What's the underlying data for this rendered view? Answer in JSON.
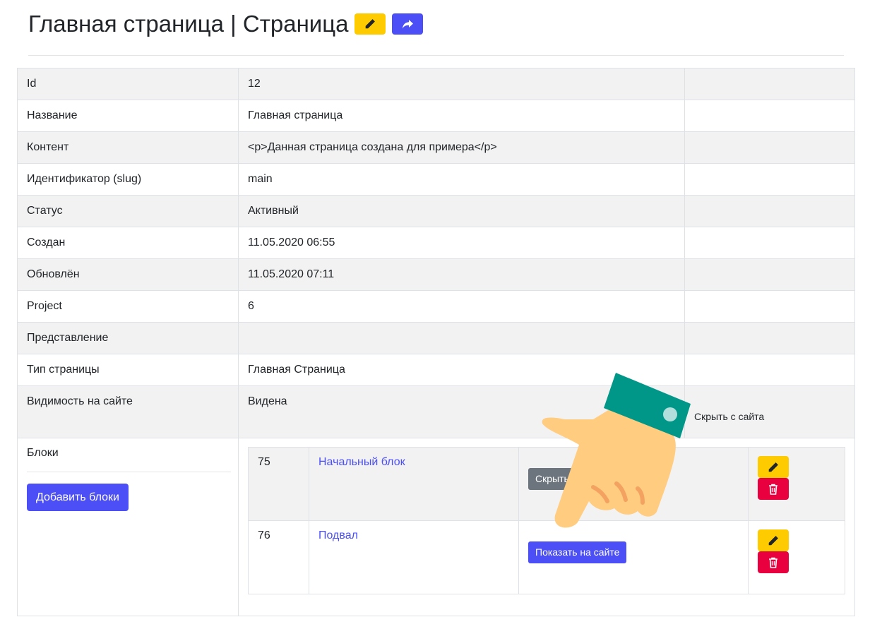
{
  "header": {
    "title": "Главная страница | Страница",
    "edit_icon": "pencil-icon",
    "share_icon": "share-arrow-icon"
  },
  "details": [
    {
      "label": "Id",
      "value": "12"
    },
    {
      "label": "Название",
      "value": "Главная страница"
    },
    {
      "label": "Контент",
      "value": "<p>Данная страница создана для примера</p>"
    },
    {
      "label": "Идентификатор (slug)",
      "value": "main"
    },
    {
      "label": "Статус",
      "value": "Активный"
    },
    {
      "label": "Создан",
      "value": "11.05.2020 06:55"
    },
    {
      "label": "Обновлён",
      "value": "11.05.2020 07:11"
    },
    {
      "label": "Project",
      "value": "6"
    },
    {
      "label": "Представление",
      "value": ""
    },
    {
      "label": "Тип страницы",
      "value": "Главная Страница"
    }
  ],
  "visibility": {
    "label": "Видимость на сайте",
    "value": "Видена",
    "action": "Скрыть с сайта"
  },
  "blocks": {
    "label": "Блоки",
    "add_button": "Добавить блоки",
    "rows": [
      {
        "id": "75",
        "name": "Начальный блок",
        "action": "Скрыть с сайта"
      },
      {
        "id": "76",
        "name": "Подвал",
        "action": "Показать на сайте"
      }
    ]
  },
  "colors": {
    "accent": "#4b4ff5",
    "warning": "#fecb00",
    "danger": "#e8003f",
    "secondary": "#6c757d",
    "hand_sleeve": "#009688",
    "hand_skin": "#ffcc80"
  }
}
